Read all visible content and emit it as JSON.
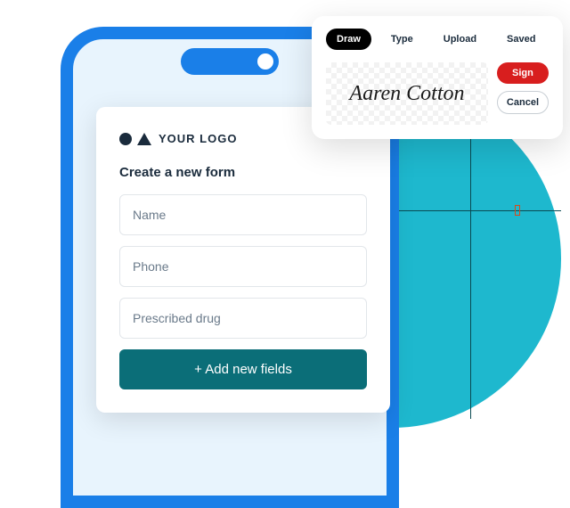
{
  "logo": {
    "text": "YOUR LOGO"
  },
  "form": {
    "title": "Create a new form",
    "fields": [
      {
        "placeholder": "Name"
      },
      {
        "placeholder": "Phone"
      },
      {
        "placeholder": "Prescribed drug"
      }
    ],
    "add_button": "+  Add new fields"
  },
  "signature": {
    "tabs": [
      "Draw",
      "Type",
      "Upload",
      "Saved"
    ],
    "active_tab": "Draw",
    "signature_text": "Aaren Cotton",
    "sign_label": "Sign",
    "cancel_label": "Cancel"
  },
  "colors": {
    "phone_frame": "#1a7fe8",
    "teal_circle": "#1eb8ce",
    "add_button": "#0b6e78",
    "sign_button": "#d81e1e"
  }
}
